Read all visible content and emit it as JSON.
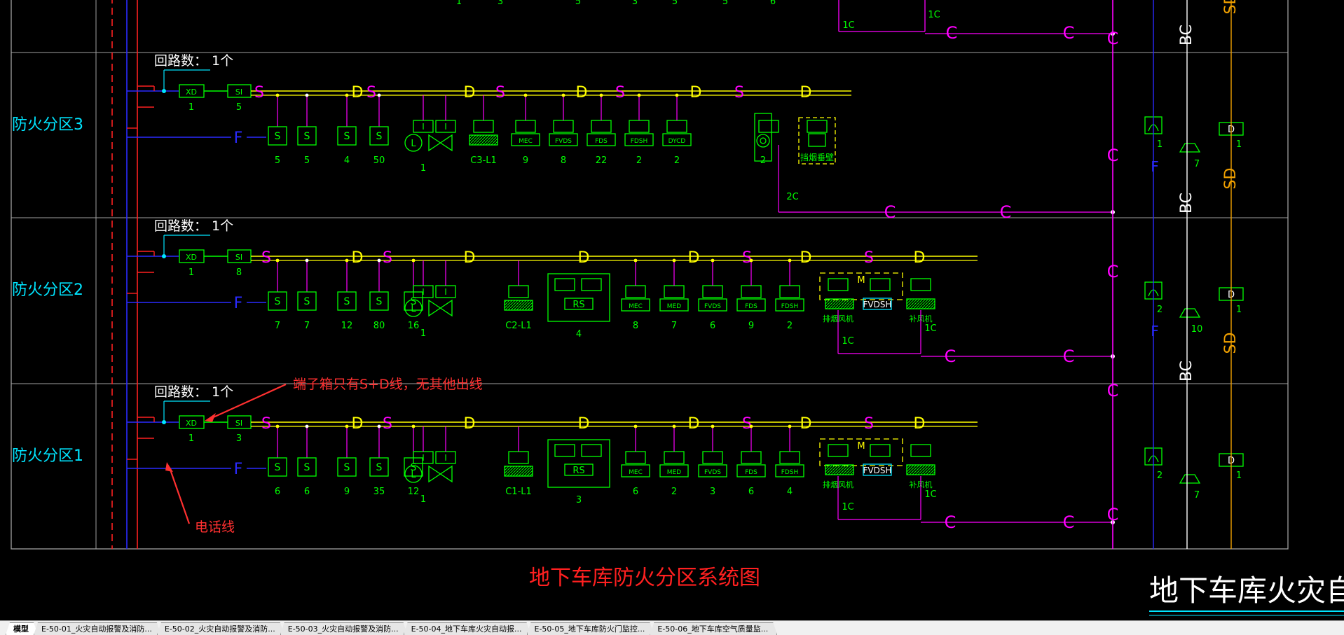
{
  "drawing": {
    "title": "地下车库防火分区系统图",
    "title_partial": "地下车库火灾自动报警及",
    "annotation_terminal": "端子箱只有S+D线，无其他出线",
    "annotation_phone": "电话线",
    "zones": [
      {
        "label": "防火分区3",
        "loop_count": "回路数：  1个",
        "xd_num": "1",
        "si_num": "5",
        "dev_nums": [
          "5",
          "5",
          "4",
          "50"
        ],
        "v_num": "1",
        "c_label": "C3-L1",
        "io_nums": [
          "9",
          "8",
          "22",
          "2",
          "2"
        ],
        "io_codes": [
          "MEC",
          "FVDS",
          "FDS",
          "FDSH",
          "DYCD"
        ],
        "extra_num": "2",
        "extra_label": "2C",
        "ahu_label": "挡烟垂壁",
        "right_nums": [
          "1",
          "7",
          "1"
        ]
      },
      {
        "label": "防火分区2",
        "loop_count": "回路数：  1个",
        "xd_num": "1",
        "si_num": "8",
        "dev_nums": [
          "7",
          "7",
          "12",
          "80",
          "16"
        ],
        "v_num": "1",
        "c_label": "C2-L1",
        "rs_num": "4",
        "io_nums": [
          "8",
          "7",
          "6",
          "9",
          "2"
        ],
        "io_codes": [
          "MEC",
          "MED",
          "FVDS",
          "FDS",
          "FDSH"
        ],
        "fan_labels": [
          "排烟风机",
          "补风机"
        ],
        "fan_code": "FVDSH",
        "loop_1c": "1C",
        "right_nums": [
          "2",
          "10",
          "1"
        ]
      },
      {
        "label": "防火分区1",
        "loop_count": "回路数：  1个",
        "xd_num": "1",
        "si_num": "3",
        "dev_nums": [
          "6",
          "6",
          "9",
          "35",
          "12"
        ],
        "v_num": "1",
        "c_label": "C1-L1",
        "rs_num": "3",
        "io_nums": [
          "6",
          "2",
          "3",
          "6",
          "4"
        ],
        "io_codes": [
          "MEC",
          "MED",
          "FVDS",
          "FDS",
          "FDSH"
        ],
        "fan_labels": [
          "排烟风机",
          "补风机"
        ],
        "fan_code": "FVDSH",
        "loop_1c": "1C",
        "right_nums": [
          "2",
          "7",
          "1"
        ]
      }
    ],
    "symbols": {
      "xd": "XD",
      "si": "SI",
      "f": "F",
      "io": "I/O",
      "i": "I",
      "rs": "RS",
      "d": "D",
      "s": "S",
      "c": "C",
      "bc": "BC",
      "sd": "SD",
      "m": "M",
      "l": "L"
    },
    "top_partial_nums": [
      "1",
      "3",
      "5",
      "3",
      "5",
      "5",
      "6"
    ],
    "top_1c": "1C"
  },
  "colors": {
    "background": "#000000",
    "red": "#ff2020",
    "blue": "#2a2aff",
    "green": "#00ff00",
    "magenta": "#ff00ff",
    "yellow": "#ffff00",
    "cyan": "#00e5ff",
    "orange": "#f0a000",
    "grid": "#a0a0a0",
    "annotation": "#ff3030"
  },
  "tabs": [
    {
      "label": "模型",
      "active": true
    },
    {
      "label": "E-50-01_火灾自动报警及消防...",
      "active": false
    },
    {
      "label": "E-50-02_火灾自动报警及消防...",
      "active": false
    },
    {
      "label": "E-50-03_火灾自动报警及消防...",
      "active": false
    },
    {
      "label": "E-50-04_地下车库火灾自动报...",
      "active": false
    },
    {
      "label": "E-50-05_地下车库防火门监控...",
      "active": false
    },
    {
      "label": "E-50-06_地下车库空气质量监...",
      "active": false
    }
  ]
}
